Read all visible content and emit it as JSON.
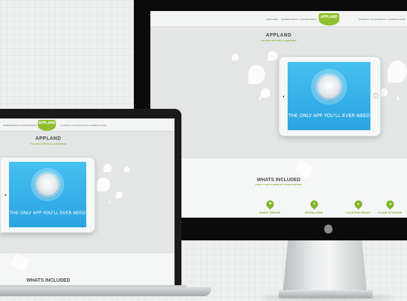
{
  "imac_site": {
    "nav": {
      "left": [
        "FEATURES",
        "SCREENSHOTS",
        "TESTIMONIALS"
      ],
      "logo": "APPLAND",
      "right": [
        "CONTACT US",
        "OUR BLOG",
        "A SAMPLE PAGE"
      ]
    },
    "hero": {
      "title": "APPLAND",
      "subtitle": "THE ONLY APP YOU'LL EVER NEED",
      "tablet_tagline": "THE ONLY APP YOU'LL EVER NEED",
      "prev_arrow": "‹",
      "next_arrow": "›"
    },
    "included": {
      "title": "WHATS INCLUDED",
      "subtitle": "HAVE A LOOK AT SOME OF THESE FEATURES",
      "features": [
        {
          "label": "SMART DESIGN",
          "icon": "design-icon"
        },
        {
          "label": "SOCIAL WISE",
          "icon": "social-icon"
        },
        {
          "label": "LOCATION READY",
          "icon": "location-icon"
        },
        {
          "label": "CLOUD STORAGE",
          "icon": "cloud-icon"
        }
      ]
    }
  },
  "macbook_site": {
    "nav": {
      "left": [
        "SCREENSHOTS",
        "TESTIMONIALS"
      ],
      "logo": "APPLAND",
      "right": [
        "CONTACT US",
        "OUR BLOG",
        "A SAMPLE PAGE"
      ]
    },
    "hero": {
      "title": "APPLAND",
      "subtitle": "THE ONLY APP YOU'LL EVER NEED",
      "tablet_tagline": "THE ONLY APP YOU'LL EVER NEED",
      "next_arrow": "›"
    },
    "included": {
      "title": "WHATS INCLUDED"
    }
  },
  "colors": {
    "accent": "#8fbf2e",
    "tablet_blue": "#35b1e8",
    "device_black": "#0b0b0b"
  }
}
